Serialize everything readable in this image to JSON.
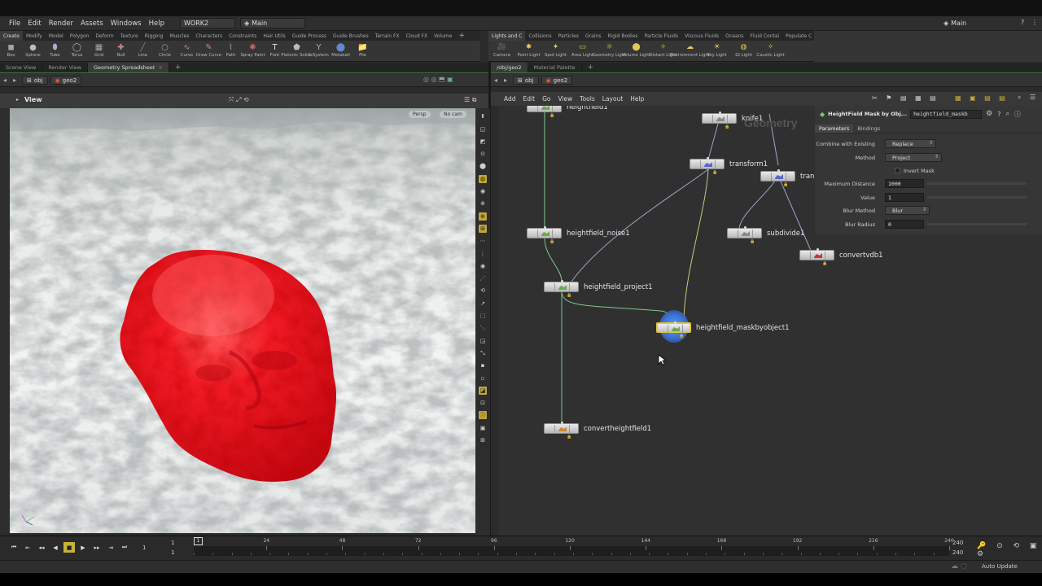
{
  "menubar": {
    "items": [
      "File",
      "Edit",
      "Render",
      "Assets",
      "Windows",
      "Help"
    ],
    "desktop": "WORK2",
    "context": "Main",
    "right_context": "Main"
  },
  "left_shelf": {
    "tabs": [
      "Create",
      "Modify",
      "Model",
      "Polygon",
      "Deform",
      "Texture",
      "Rigging",
      "Muscles",
      "Characters",
      "Constraints",
      "Hair Utils",
      "Guide Process",
      "Guide Brushes",
      "Terrain FX",
      "Cloud FX",
      "Volume"
    ],
    "tools": [
      "Box",
      "Sphere",
      "Tube",
      "Torus",
      "Grid",
      "Null",
      "Line",
      "Circle",
      "Curve",
      "Draw Curve",
      "Path",
      "Spray Paint",
      "Font",
      "Platonic Solids",
      "L-System",
      "Metaball",
      "File"
    ]
  },
  "right_shelf": {
    "tabs": [
      "Lights and C",
      "Collisions",
      "Particles",
      "Grains",
      "Rigid Bodies",
      "Particle Fluids",
      "Viscous Fluids",
      "Oceans",
      "Fluid Contai",
      "Populate C"
    ],
    "tools": [
      "Camera",
      "Point Light",
      "Spot Light",
      "Area Light",
      "Geometry Light",
      "Volume Light",
      "Distant Light",
      "Environment Light",
      "Sky Light",
      "GI Light",
      "Caustic Light"
    ]
  },
  "left_pane": {
    "tabs": [
      "Scene View",
      "Render View",
      "Geometry Spreadsheet"
    ],
    "path": [
      "obj",
      "geo2"
    ],
    "view_label": "View",
    "camera_menu": "Persp",
    "cam_menu": "No cam"
  },
  "right_pane": {
    "tabs": [
      "/obj/geo2",
      "Material Palette"
    ],
    "path": [
      "obj",
      "geo2"
    ],
    "menu": [
      "Add",
      "Edit",
      "Go",
      "View",
      "Tools",
      "Layout",
      "Help"
    ],
    "watermark": "Geometry"
  },
  "nodes": [
    {
      "id": "heightfield1",
      "label": "heightfield1"
    },
    {
      "id": "knife1",
      "label": "knife1"
    },
    {
      "id": "transform1",
      "label": "transform1"
    },
    {
      "id": "tran",
      "label": "tran"
    },
    {
      "id": "heightfield_noise1",
      "label": "heightfield_noise1"
    },
    {
      "id": "subdivide1",
      "label": "subdivide1"
    },
    {
      "id": "convertvdb1",
      "label": "convertvdb1"
    },
    {
      "id": "heightfield_project1",
      "label": "heightfield_project1"
    },
    {
      "id": "heightfield_maskbyobject1",
      "label": "heightfield_maskbyobject1"
    },
    {
      "id": "convertheightfield1",
      "label": "convertheightfield1"
    }
  ],
  "parms": {
    "node_type": "HeightField Mask by Obj...",
    "node_name": "heightfield_maskb",
    "tabs": [
      "Parameters",
      "Bindings"
    ],
    "combine_label": "Combine with Existing",
    "combine_value": "Replace",
    "method_label": "Method",
    "method_value": "Project",
    "invert_label": "Invert Mask",
    "maxdist_label": "Maximum Distance",
    "maxdist_value": "1000",
    "value_label": "Value",
    "value_value": "1",
    "blurmethod_label": "Blur Method",
    "blurmethod_value": "Blur",
    "blurradius_label": "Blur Radius",
    "blurradius_value": "0"
  },
  "timeline": {
    "current_frame": "1",
    "start": "1",
    "start2": "1",
    "ticks": [
      "1",
      "24",
      "48",
      "72",
      "96",
      "120",
      "144",
      "168",
      "192",
      "216",
      "240"
    ],
    "end": "240",
    "end2": "240"
  },
  "status": {
    "auto_update": "Auto Update"
  },
  "colors": {
    "accent_yellow": "#c9b13a",
    "head_red": "#e4101c",
    "selected_node": "#3aa0ff"
  }
}
